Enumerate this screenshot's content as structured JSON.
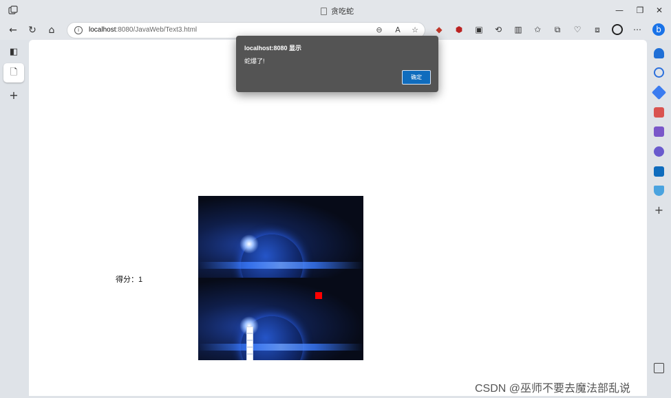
{
  "window": {
    "tab_title": "贪吃蛇"
  },
  "toolbar": {
    "url_host": "localhost",
    "url_path": ":8080/JavaWeb/Text3.html"
  },
  "page": {
    "score_label": "得分：",
    "score_value": "1"
  },
  "game": {
    "food": {
      "col": 17,
      "row": 14
    },
    "snake": [
      {
        "col": 7,
        "row": 19
      },
      {
        "col": 7,
        "row": 20
      },
      {
        "col": 7,
        "row": 21
      },
      {
        "col": 7,
        "row": 22
      },
      {
        "col": 7,
        "row": 23
      }
    ],
    "food_color": "#ff0000",
    "snake_color": "#ffffff"
  },
  "dialog": {
    "title": "localhost:8080 显示",
    "message": "蛇爆了!",
    "ok_label": "确定"
  },
  "watermark": "CSDN @巫师不要去魔法部乱说",
  "colors": {
    "accent": "#0f6cbd",
    "dialog_bg": "#545454"
  }
}
